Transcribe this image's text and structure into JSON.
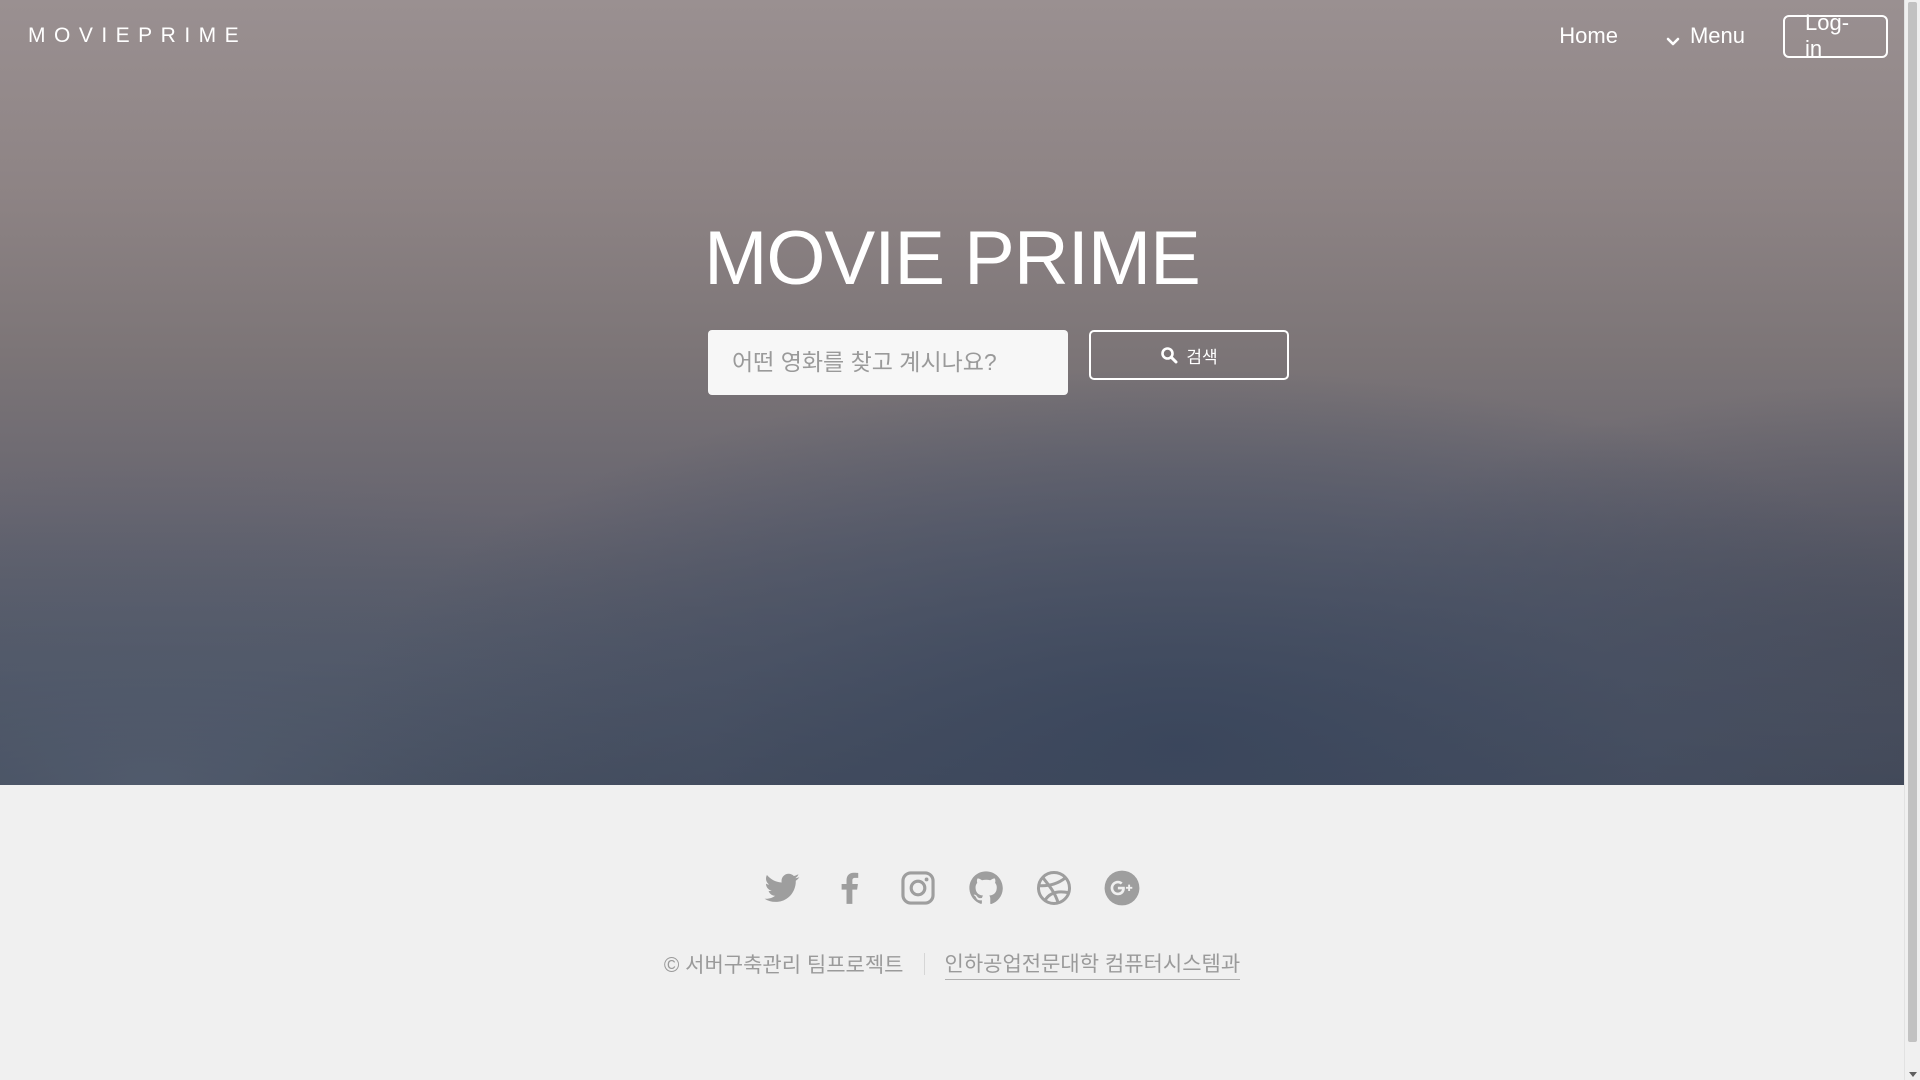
{
  "header": {
    "brand": "MOVIEPRIME",
    "nav": {
      "home_label": "Home",
      "menu_label": "Menu",
      "login_label": "Log-in"
    }
  },
  "hero": {
    "title": "MOVIE PRIME",
    "search": {
      "placeholder": "어떤 영화를 찾고 계시나요?",
      "value": "",
      "button_label": "검색"
    }
  },
  "footer": {
    "social_icons": [
      "twitter-icon",
      "facebook-icon",
      "instagram-icon",
      "github-icon",
      "dribbble-icon",
      "google-plus-icon"
    ],
    "copyright": "© 서버구축관리 팀프로젝트",
    "school_link": "인하공업전문대학 컴퓨터시스템과"
  },
  "colors": {
    "hero_top": "#9a9091",
    "hero_bottom": "#3c4555",
    "footer_bg": "#f0f0f0",
    "footer_text": "#9a9a9a",
    "white": "#ffffff"
  }
}
